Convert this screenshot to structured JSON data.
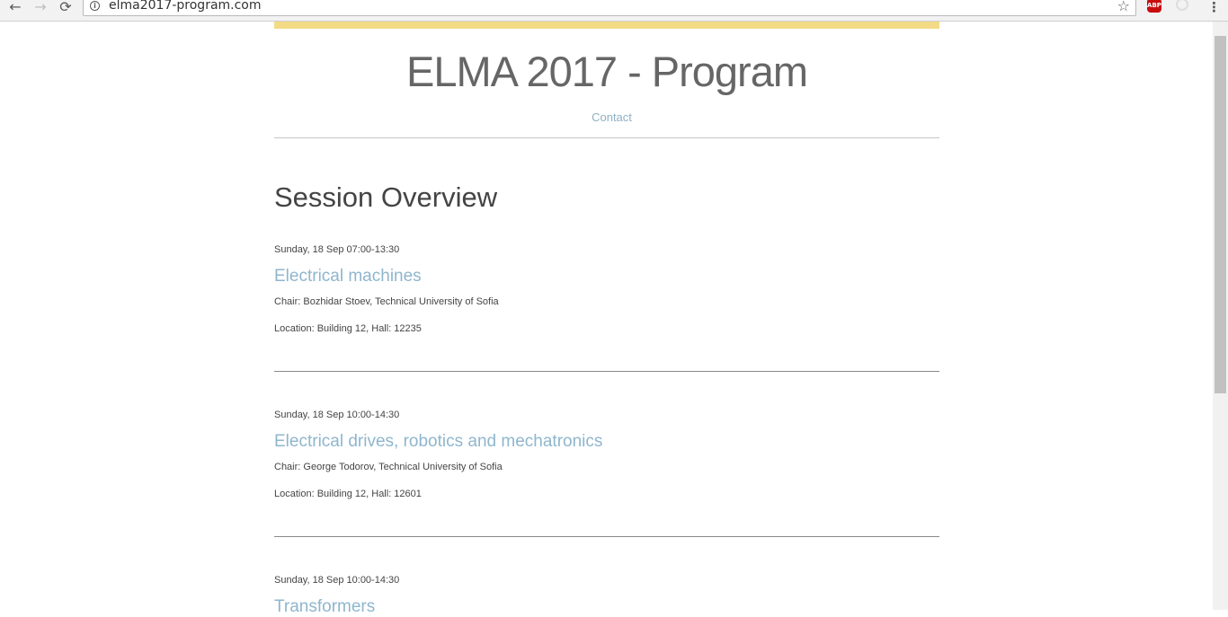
{
  "browser": {
    "url": "elma2017-program.com",
    "back_glyph": "←",
    "forward_glyph": "→",
    "reload_glyph": "⟳",
    "info_glyph": "i",
    "star_glyph": "☆",
    "adblock_label": "ABP",
    "menu_glyph": "⋮"
  },
  "site": {
    "title": "ELMA 2017 - Program",
    "nav": {
      "contact": "Contact"
    }
  },
  "main": {
    "heading": "Session Overview",
    "sessions": [
      {
        "time": "Sunday, 18 Sep 07:00-13:30",
        "title": "Electrical machines",
        "chair": "Chair: Bozhidar Stoev, Technical University of Sofia",
        "location": "Location: Building 12, Hall: 12235"
      },
      {
        "time": "Sunday, 18 Sep 10:00-14:30",
        "title": "Electrical drives, robotics and mechatronics",
        "chair": "Chair: George Todorov, Technical University of Sofia",
        "location": "Location: Building 12, Hall: 12601"
      },
      {
        "time": "Sunday, 18 Sep 10:00-14:30",
        "title": "Transformers"
      }
    ]
  },
  "colors": {
    "accent_bar": "#f3db86",
    "link": "#8fb6cd",
    "title_text": "#666666",
    "body_text": "#444444"
  }
}
